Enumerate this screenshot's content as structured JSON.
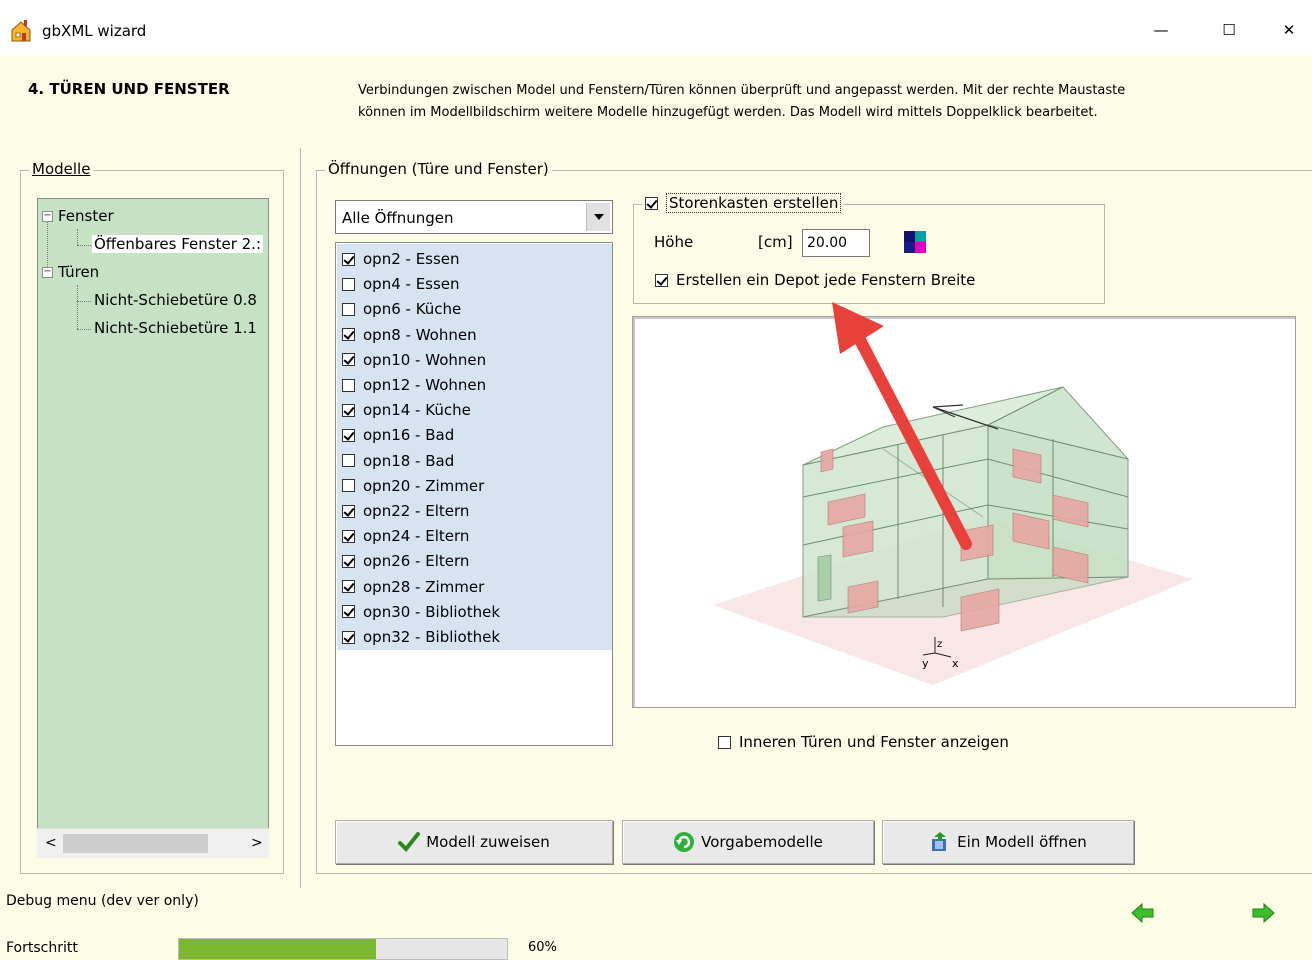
{
  "window": {
    "title": "gbXML wizard",
    "minimize_glyph": "—",
    "maximize_glyph": "☐",
    "close_glyph": "✕"
  },
  "header": {
    "step_title": "4.  TÜREN UND FENSTER",
    "description": "Verbindungen zwischen Model und Fenstern/Türen können überprüft und angepasst werden. Mit der rechte Maustaste können im Modellbildschirm weitere Modelle hinzugefügt werden. Das Modell wird mittels Doppelklick bearbeitet."
  },
  "modelle": {
    "legend": "Modelle",
    "tree": [
      {
        "label": "Fenster",
        "expanded": true,
        "children": [
          "Öffenbares Fenster 2.:"
        ]
      },
      {
        "label": "Türen",
        "expanded": true,
        "children": [
          "Nicht-Schiebetüre 0.8",
          "Nicht-Schiebetüre 1.1"
        ]
      }
    ],
    "selected": "Öffenbares Fenster 2.:",
    "scroll_left": "<",
    "scroll_right": ">"
  },
  "oeffnungen": {
    "legend": "Öffnungen (Türe und Fenster)",
    "filter_value": "Alle Öffnungen",
    "items": [
      {
        "label": "opn2 - Essen",
        "checked": true
      },
      {
        "label": "opn4 - Essen",
        "checked": false
      },
      {
        "label": "opn6 - Küche",
        "checked": false
      },
      {
        "label": "opn8 - Wohnen",
        "checked": true
      },
      {
        "label": "opn10 - Wohnen",
        "checked": true
      },
      {
        "label": "opn12 - Wohnen",
        "checked": false
      },
      {
        "label": "opn14 - Küche",
        "checked": true
      },
      {
        "label": "opn16 - Bad",
        "checked": true
      },
      {
        "label": "opn18 - Bad",
        "checked": false
      },
      {
        "label": "opn20 - Zimmer",
        "checked": false
      },
      {
        "label": "opn22 - Eltern",
        "checked": true
      },
      {
        "label": "opn24 - Eltern",
        "checked": true
      },
      {
        "label": "opn26 - Eltern",
        "checked": true
      },
      {
        "label": "opn28 - Zimmer",
        "checked": true
      },
      {
        "label": "opn30 - Bibliothek",
        "checked": true
      },
      {
        "label": "opn32 - Bibliothek",
        "checked": true
      }
    ]
  },
  "storenkasten": {
    "label": "Storenkasten erstellen",
    "checked": true,
    "hoehe_label": "Höhe",
    "unit_label": "[cm]",
    "hoehe_value": "20.00",
    "depot_label": "Erstellen ein Depot jede Fenstern Breite",
    "depot_checked": true
  },
  "view3d": {
    "axis_x": "x",
    "axis_y": "y",
    "axis_z": "z"
  },
  "inner_toggle": {
    "label": "Inneren Türen und Fenster anzeigen",
    "checked": false
  },
  "buttons": {
    "assign": "Modell zuweisen",
    "defaults": "Vorgabemodelle",
    "open": "Ein Modell öffnen"
  },
  "footer": {
    "debug_menu": "Debug menu (dev ver only)",
    "progress_label": "Fortschritt",
    "progress_percent": 60,
    "progress_text": "60%"
  },
  "colors": {
    "background": "#fdfce6",
    "tree_bg": "#c5e2c5",
    "list_bg": "#d6e4f2",
    "progress": "#7cb82e",
    "arrow": "#e8413c",
    "nav_green": "#3cbf2a"
  }
}
